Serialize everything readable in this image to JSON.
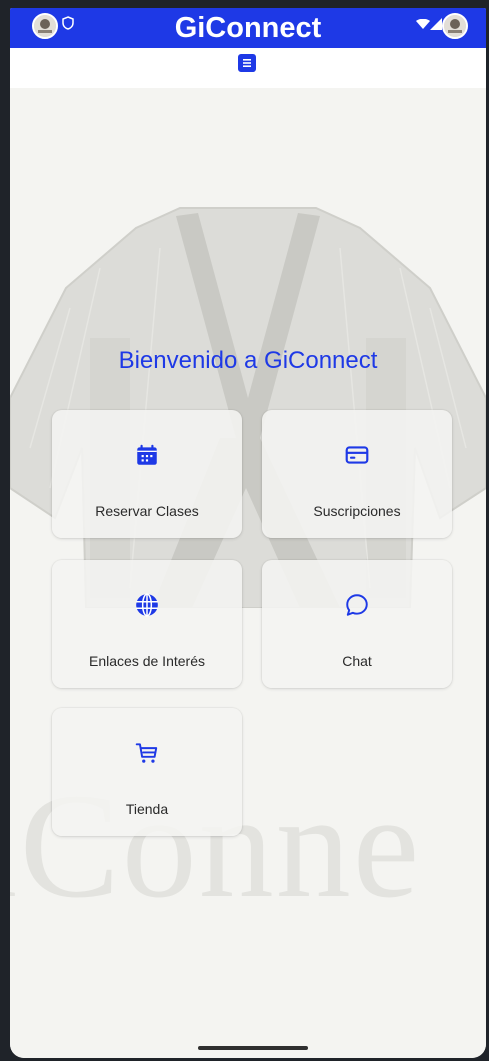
{
  "app": {
    "title": "GiConnect"
  },
  "header": {
    "menu_icon": "menu-icon"
  },
  "main": {
    "welcome": "Bienvenido a GiConnect",
    "background_word": "iConne",
    "cards": [
      {
        "label": "Reservar Clases",
        "icon": "calendar-icon"
      },
      {
        "label": "Suscripciones",
        "icon": "credit-card-icon"
      },
      {
        "label": "Enlaces de Interés",
        "icon": "globe-icon"
      },
      {
        "label": "Chat",
        "icon": "chat-bubble-icon"
      },
      {
        "label": "Tienda",
        "icon": "shopping-cart-icon"
      }
    ]
  },
  "colors": {
    "brand": "#1e39e6",
    "background": "#f4f4f1",
    "text": "#2a2a2a"
  }
}
